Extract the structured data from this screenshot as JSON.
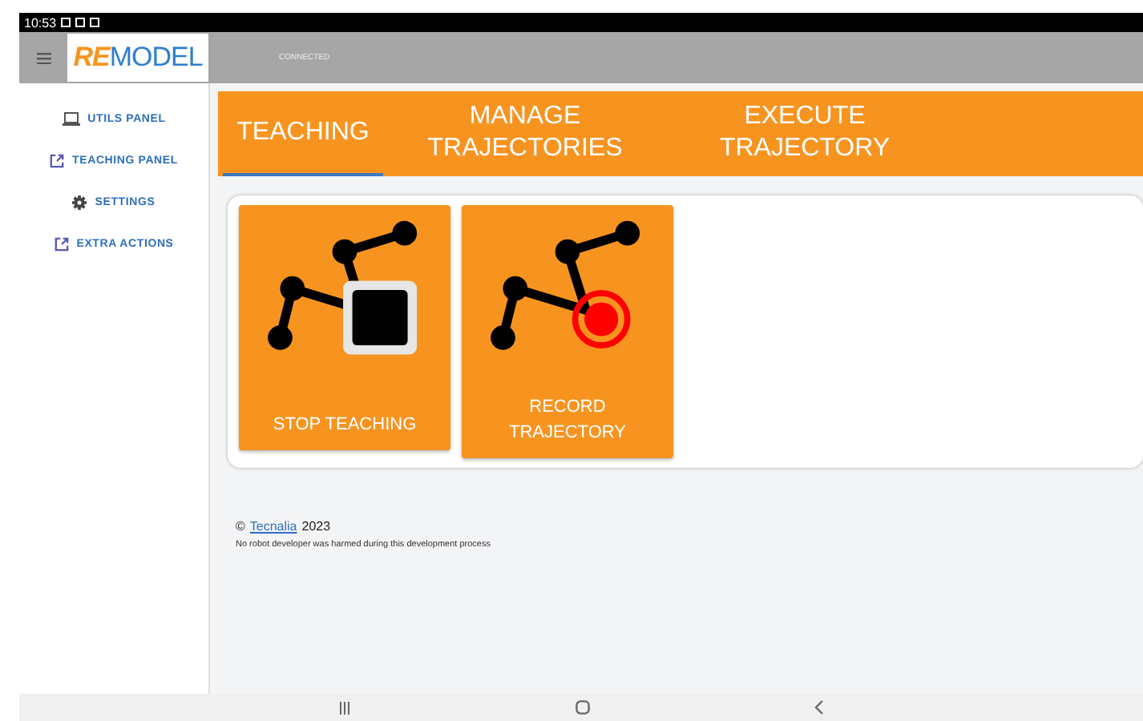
{
  "status_bar": {
    "time": "10:53"
  },
  "header": {
    "logo": {
      "lead": "RE",
      "rest": "MODEL"
    },
    "connection": "CONNECTED"
  },
  "sidebar": {
    "items": [
      {
        "label": "UTILS PANEL",
        "kind": "laptop"
      },
      {
        "label": "TEACHING PANEL",
        "kind": "external"
      },
      {
        "label": "SETTINGS",
        "kind": "gear"
      },
      {
        "label": "EXTRA ACTIONS",
        "kind": "external"
      }
    ]
  },
  "tabs": [
    {
      "label": "TEACHING",
      "selected": true
    },
    {
      "label": "MANAGE TRAJECTORIES",
      "selected": false
    },
    {
      "label": "EXECUTE TRAJECTORY",
      "selected": false
    }
  ],
  "actions": [
    {
      "label": "STOP TEACHING",
      "kind": "stop"
    },
    {
      "label": "RECORD TRAJECTORY",
      "kind": "record"
    }
  ],
  "footer": {
    "copyright": "©",
    "link": "Tecnalia",
    "year": "2023",
    "note": "No robot developer was harmed during this development process"
  }
}
